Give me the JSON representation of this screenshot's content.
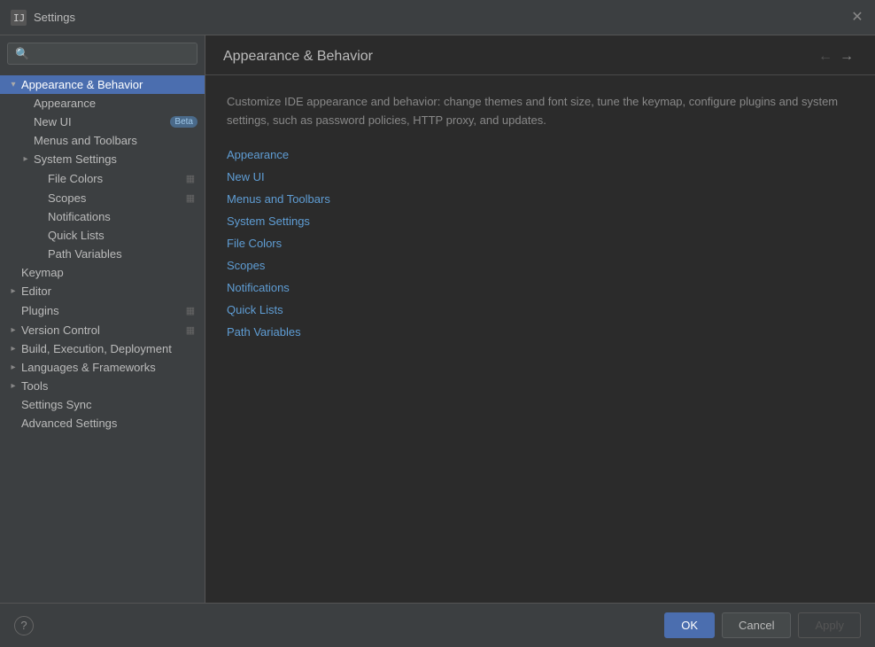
{
  "titleBar": {
    "title": "Settings",
    "closeIcon": "✕"
  },
  "sidebar": {
    "searchPlaceholder": "🔍",
    "items": [
      {
        "id": "appearance-behavior",
        "label": "Appearance & Behavior",
        "indent": 0,
        "hasChevron": true,
        "chevronExpanded": true,
        "selected": true,
        "hasIconBtn": false
      },
      {
        "id": "appearance",
        "label": "Appearance",
        "indent": 1,
        "hasChevron": false,
        "selected": false,
        "hasIconBtn": false
      },
      {
        "id": "new-ui",
        "label": "New UI",
        "indent": 1,
        "hasChevron": false,
        "selected": false,
        "hasBadge": true,
        "badge": "Beta",
        "hasIconBtn": false
      },
      {
        "id": "menus-toolbars",
        "label": "Menus and Toolbars",
        "indent": 1,
        "hasChevron": false,
        "selected": false,
        "hasIconBtn": false
      },
      {
        "id": "system-settings",
        "label": "System Settings",
        "indent": 1,
        "hasChevron": true,
        "chevronExpanded": false,
        "selected": false,
        "hasIconBtn": false
      },
      {
        "id": "file-colors",
        "label": "File Colors",
        "indent": 2,
        "hasChevron": false,
        "selected": false,
        "hasIconBtn": true,
        "iconBtn": "▦"
      },
      {
        "id": "scopes",
        "label": "Scopes",
        "indent": 2,
        "hasChevron": false,
        "selected": false,
        "hasIconBtn": true,
        "iconBtn": "▦"
      },
      {
        "id": "notifications",
        "label": "Notifications",
        "indent": 2,
        "hasChevron": false,
        "selected": false,
        "hasIconBtn": false
      },
      {
        "id": "quick-lists",
        "label": "Quick Lists",
        "indent": 2,
        "hasChevron": false,
        "selected": false,
        "hasIconBtn": false
      },
      {
        "id": "path-variables",
        "label": "Path Variables",
        "indent": 2,
        "hasChevron": false,
        "selected": false,
        "hasIconBtn": false
      },
      {
        "id": "keymap",
        "label": "Keymap",
        "indent": 0,
        "hasChevron": false,
        "selected": false,
        "hasIconBtn": false
      },
      {
        "id": "editor",
        "label": "Editor",
        "indent": 0,
        "hasChevron": true,
        "chevronExpanded": false,
        "selected": false,
        "hasIconBtn": false
      },
      {
        "id": "plugins",
        "label": "Plugins",
        "indent": 0,
        "hasChevron": false,
        "selected": false,
        "hasIconBtn": true,
        "iconBtn": "▦"
      },
      {
        "id": "version-control",
        "label": "Version Control",
        "indent": 0,
        "hasChevron": true,
        "chevronExpanded": false,
        "selected": false,
        "hasIconBtn": true,
        "iconBtn": "▦"
      },
      {
        "id": "build-execution",
        "label": "Build, Execution, Deployment",
        "indent": 0,
        "hasChevron": true,
        "chevronExpanded": false,
        "selected": false,
        "hasIconBtn": false
      },
      {
        "id": "languages-frameworks",
        "label": "Languages & Frameworks",
        "indent": 0,
        "hasChevron": true,
        "chevronExpanded": false,
        "selected": false,
        "hasIconBtn": false
      },
      {
        "id": "tools",
        "label": "Tools",
        "indent": 0,
        "hasChevron": true,
        "chevronExpanded": false,
        "selected": false,
        "hasIconBtn": false
      },
      {
        "id": "settings-sync",
        "label": "Settings Sync",
        "indent": 0,
        "hasChevron": false,
        "selected": false,
        "hasIconBtn": false
      },
      {
        "id": "advanced-settings",
        "label": "Advanced Settings",
        "indent": 0,
        "hasChevron": false,
        "selected": false,
        "hasIconBtn": false
      }
    ]
  },
  "content": {
    "title": "Appearance & Behavior",
    "description": "Customize IDE appearance and behavior: change themes and font size, tune the keymap, configure plugins and system settings, such as password policies, HTTP proxy, and updates.",
    "links": [
      {
        "id": "appearance",
        "label": "Appearance"
      },
      {
        "id": "new-ui",
        "label": "New UI"
      },
      {
        "id": "menus-toolbars",
        "label": "Menus and Toolbars"
      },
      {
        "id": "system-settings",
        "label": "System Settings"
      },
      {
        "id": "file-colors",
        "label": "File Colors"
      },
      {
        "id": "scopes",
        "label": "Scopes"
      },
      {
        "id": "notifications",
        "label": "Notifications"
      },
      {
        "id": "quick-lists",
        "label": "Quick Lists"
      },
      {
        "id": "path-variables",
        "label": "Path Variables"
      }
    ]
  },
  "footer": {
    "helpIcon": "?",
    "okLabel": "OK",
    "cancelLabel": "Cancel",
    "applyLabel": "Apply"
  }
}
